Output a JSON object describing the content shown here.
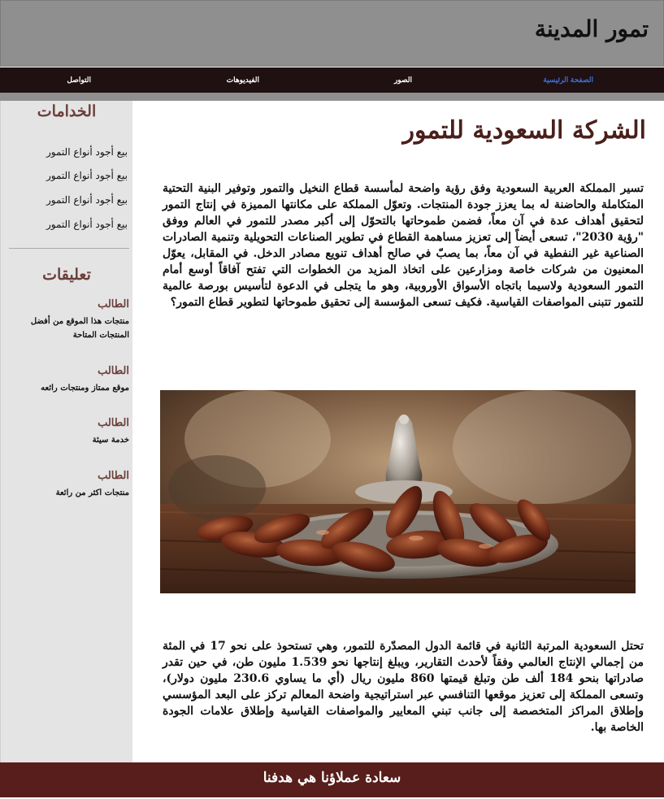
{
  "site_title": "تمور المدينة",
  "nav": {
    "home": "الصفحة الرئيسية",
    "images": "الصور",
    "videos": "الفيديوهات",
    "contact": "التواصل",
    "active_color": "#3b6fd6"
  },
  "sidebar": {
    "services_heading": "الخدامات",
    "services": [
      "بيع أجود أنواع التمور",
      "بيع أجود أنواع التمور",
      "بيع أجود أنواع التمور",
      "بيع أجود أنواع التمور"
    ],
    "comments_heading": "تعليقات",
    "comments": [
      {
        "author": "الطالب",
        "text": "منتجات هذا الموقع من أفضل المنتجات المتاحة"
      },
      {
        "author": "الطالب",
        "text": "موقع ممتاز ومنتجات رائعه"
      },
      {
        "author": "الطالب",
        "text": "خدمة سيئة"
      },
      {
        "author": "الطالب",
        "text": "منتجات اكثر من رائعة"
      }
    ]
  },
  "main": {
    "title": "الشركة السعودية للتمور",
    "paragraph_1": "تسير المملكة العربية السعودية وفق رؤية واضحة لمأسسة قطاع النخيل والتمور وتوفير البنية التحتية المتكاملة والحاضنة له بما يعزز جودة المنتجات. وتعوّل المملكة على مكانتها المميزة في إنتاج التمور لتحقيق أهداف عدة في آن معاً، فضمن طموحاتها بالتحوّل إلى أكبر مصدر للتمور في العالم ووفق \"رؤية 2030\"، تسعى أيضاً إلى تعزيز مساهمة القطاع في تطوير الصناعات التحويلية وتنمية الصادرات الصناعية غير النفطية في آن معاً، بما يصبّ في صالح أهداف تنويع مصادر الدخل. في المقابل، يعوّل المعنيون من شركات خاصة ومزارعين على اتخاذ المزيد من الخطوات التي تفتح آفاقاً أوسع أمام التمور السعودية ولاسيما باتجاه الأسواق الأوروبية، وهو ما يتجلى في الدعوة لتأسيس بورصة عالمية للتمور تتبنى المواصفات القياسية. فكيف تسعى المؤسسة إلى تحقيق طموحاتها لتطوير قطاع التمور؟",
    "paragraph_2": "تحتل السعودية المرتبة الثانية في قائمة الدول المصدّرة للتمور، وهي تستحوذ على نحو 17 في المئة من إجمالي الإنتاج العالمي وفقاً لأحدث التقارير، ويبلغ إنتاجها نحو 1.539 مليون طن، في حين تقدر صادراتها بنحو 184 ألف طن وتبلغ قيمتها 860 مليون ريال (أي ما يساوي 230.6 مليون دولار)، وتسعى المملكة إلى تعزيز موقعها التنافسي عبر استراتيجية واضحة المعالم تركز على البعد المؤسسي وإطلاق المراكز المتخصصة إلى جانب تبني المعايير والمواصفات القياسية وإطلاق علامات الجودة الخاصة بها."
  },
  "footer": {
    "text": "سعادة عملاؤنا هي هدفنا"
  },
  "colors": {
    "header_bg": "#8f8f8f",
    "nav_bg": "#1f1012",
    "sidebar_bg": "#e4e4e4",
    "accent_brown": "#6b3f3a",
    "footer_bg": "#571e1c"
  }
}
